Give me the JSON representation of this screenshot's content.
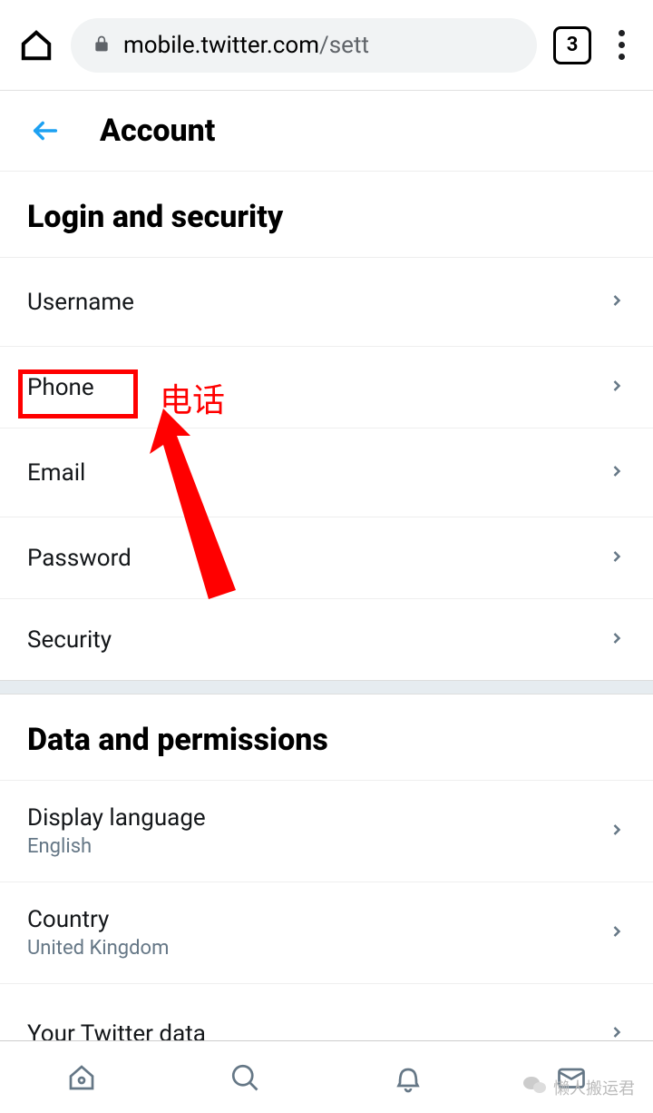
{
  "browser": {
    "url_host": "mobile.twitter.com",
    "url_path": "/sett",
    "tab_count": "3"
  },
  "header": {
    "title": "Account"
  },
  "sections": {
    "login_security": {
      "title": "Login and security",
      "items": {
        "username": "Username",
        "phone": "Phone",
        "email": "Email",
        "password": "Password",
        "security": "Security"
      }
    },
    "data_permissions": {
      "title": "Data and permissions",
      "items": {
        "display_language": {
          "label": "Display language",
          "value": "English"
        },
        "country": {
          "label": "Country",
          "value": "United Kingdom"
        },
        "your_twitter_data": {
          "label": "Your Twitter data"
        }
      }
    }
  },
  "annotation": {
    "text": "电话"
  },
  "watermark": {
    "text": "懒人搬运君"
  }
}
